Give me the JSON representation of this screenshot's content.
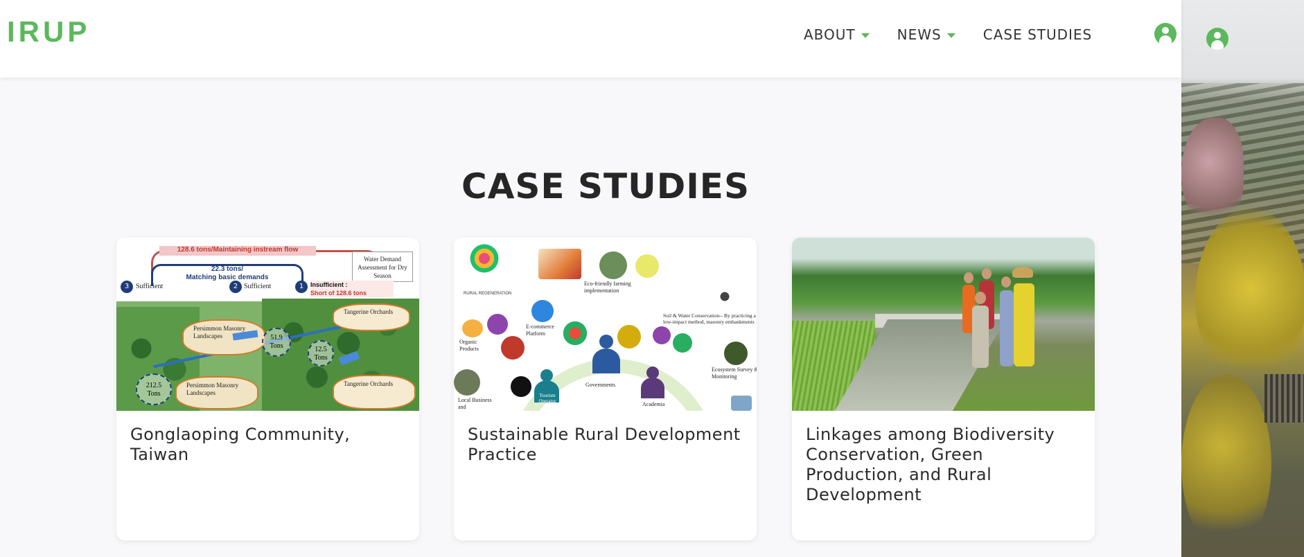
{
  "header": {
    "logo": "IRUP",
    "nav": [
      {
        "label": "ABOUT",
        "has_dropdown": true
      },
      {
        "label": "NEWS",
        "has_dropdown": true
      },
      {
        "label": "CASE STUDIES",
        "has_dropdown": false
      }
    ],
    "user_icon": "user-circle-icon"
  },
  "section": {
    "title": "CASE STUDIES"
  },
  "cards": [
    {
      "title": "Gonglaoping Community, Taiwan",
      "image": {
        "flow_label": "128.6 tons/Maintaining instream flow",
        "blue_label_1": "22.3 tons/",
        "blue_label_2": "Matching basic demands",
        "water_box": "Water Demand Assessment for Dry Season",
        "sufficient_1": "Sufficient",
        "sufficient_2": "Sufficient",
        "insufficient": "Insufficient :",
        "short": "Short of 128.6 tons",
        "badge_1": "1",
        "badge_2": "2",
        "badge_3": "3",
        "tons_a": "51.9",
        "tons_b": "12.5",
        "tons_c": "212.5",
        "tons_unit": "Tons",
        "orchard_1": "Tangerine Orchards",
        "orchard_2": "Tangerine Orchards",
        "persimmon_1": "Persimmon Masonry Landscapes",
        "persimmon_2": "Persimmon Masonry Landscapes"
      }
    },
    {
      "title": "Sustainable Rural Development Practice",
      "image": {
        "rural": "RURAL REGENERATION",
        "eco": "Eco-friendly farming implementation",
        "soil": "Soil & Water Conservation-- By practicing a low-impact method, masonry embankments",
        "ecommerce": "E-commerce Platform",
        "organic": "Organic Products",
        "ecosystem": "Ecosystem Survey & Monitoring",
        "governments": "Governments",
        "academia": "Academia",
        "tourism": "Tourism Operator",
        "local": "Local Business and"
      }
    },
    {
      "title": "Linkages among Biodiversity Conservation, Green Production, and Rural Development",
      "image": {}
    }
  ],
  "colors": {
    "accent": "#5cb85c",
    "text": "#262626",
    "background": "#f8f8fa"
  }
}
